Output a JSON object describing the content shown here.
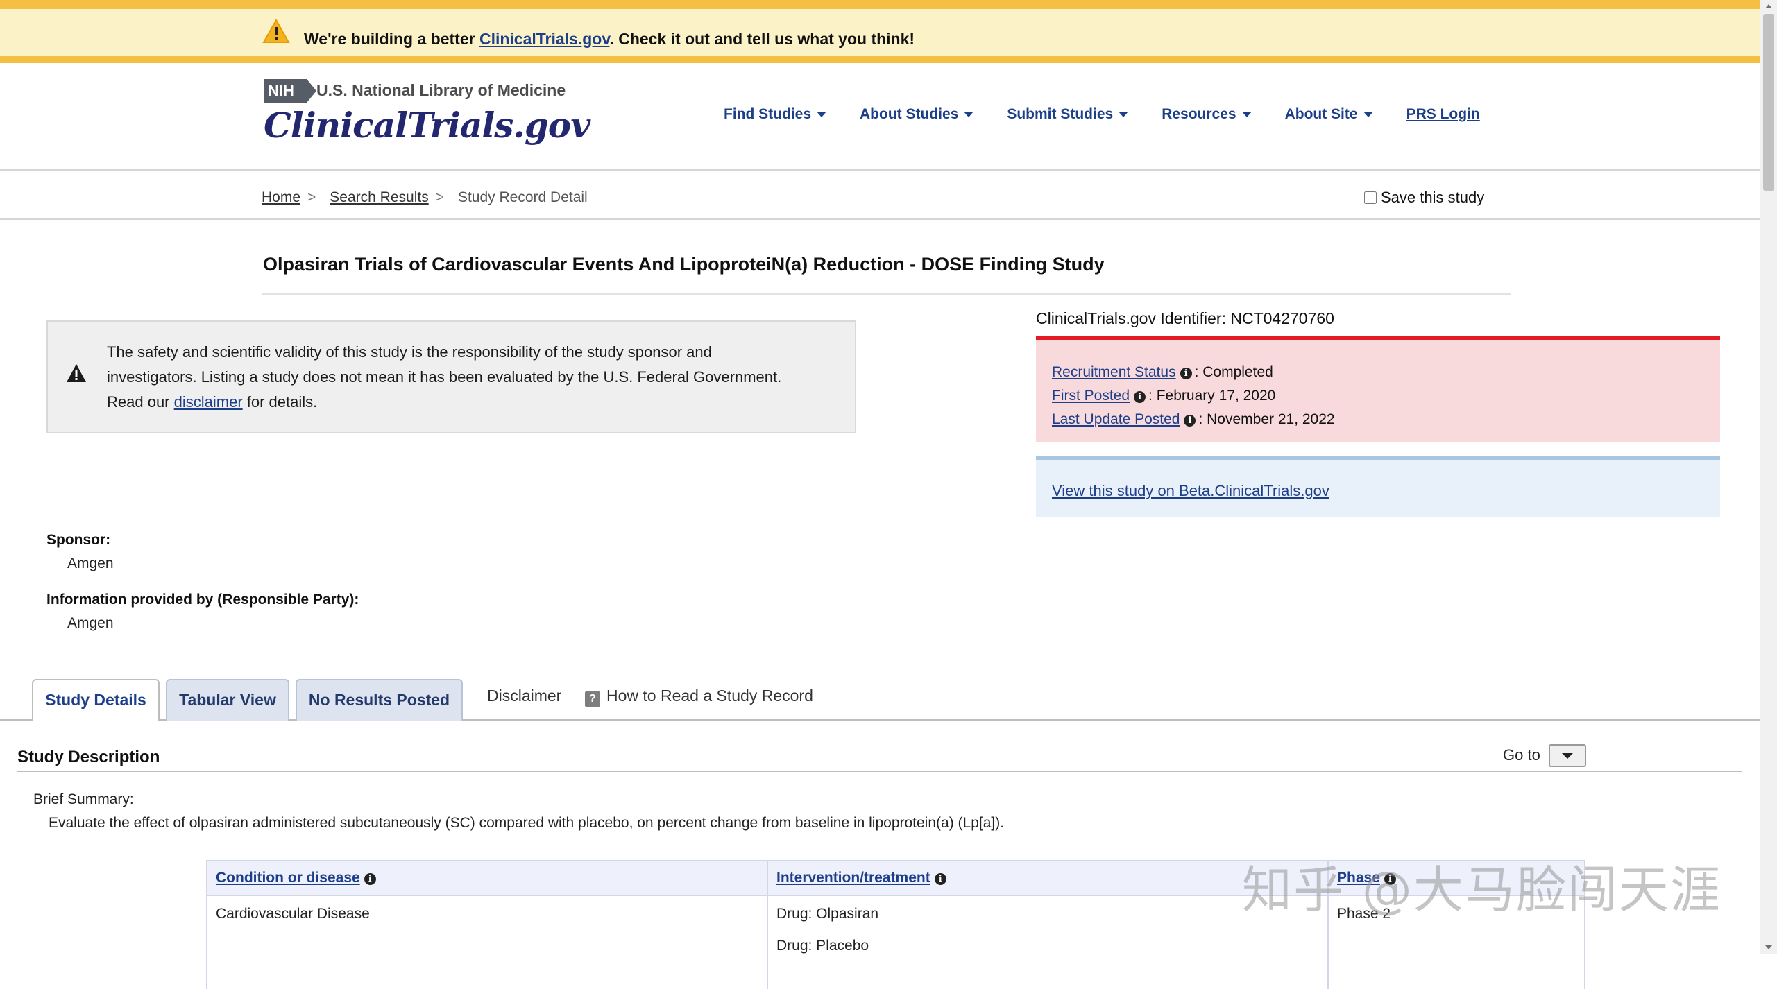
{
  "banner": {
    "prefix": "We're building a better ",
    "link": "ClinicalTrials.gov",
    "suffix": ". Check it out and tell us what you think!"
  },
  "header": {
    "nih_badge": "NIH",
    "org": "U.S. National Library of Medicine",
    "logo": "ClinicalTrials.gov",
    "nav": {
      "find": "Find Studies",
      "about_studies": "About Studies",
      "submit": "Submit Studies",
      "resources": "Resources",
      "about_site": "About Site",
      "prs": "PRS Login"
    }
  },
  "breadcrumb": {
    "home": "Home",
    "search": "Search Results",
    "current": "Study Record Detail",
    "sep": ">"
  },
  "save_study": "Save this study",
  "study": {
    "title": "Olpasiran Trials of Cardiovascular Events And LipoproteiN(a) Reduction - DOSE Finding Study",
    "identifier": "ClinicalTrials.gov Identifier: NCT04270760"
  },
  "disclaimer": {
    "line1": "The safety and scientific validity of this study is the responsibility of the study sponsor and",
    "line2": "investigators. Listing a study does not mean it has been evaluated by the U.S. Federal Government.",
    "line3_pre": "Read our ",
    "line3_link": "disclaimer",
    "line3_post": " for details."
  },
  "status": {
    "recruitment_label": "Recruitment Status",
    "recruitment_value": ": Completed",
    "first_posted_label": "First Posted",
    "first_posted_value": ": February 17, 2020",
    "last_update_label": "Last Update Posted",
    "last_update_value": ": November 21, 2022"
  },
  "beta_link": "View this study on Beta.ClinicalTrials.gov",
  "sponsor": {
    "label": "Sponsor:",
    "value": "Amgen",
    "info_label": "Information provided by (Responsible Party):",
    "info_value": "Amgen"
  },
  "tabs": {
    "details": "Study Details",
    "tabular": "Tabular View",
    "results": "No Results Posted",
    "disclaimer": "Disclaimer",
    "how_icon": "?",
    "how_to": "How to Read a Study Record"
  },
  "description": {
    "title": "Study Description",
    "goto": "Go to",
    "brief_label": "Brief Summary:",
    "brief_text": "Evaluate the effect of olpasiran administered subcutaneously (SC) compared with placebo, on percent change from baseline in lipoprotein(a) (Lp[a])."
  },
  "table": {
    "headers": [
      "Condition or disease",
      "Intervention/treatment",
      "Phase"
    ],
    "condition": "Cardiovascular Disease",
    "interventions": [
      "Drug: Olpasiran",
      "Drug: Placebo"
    ],
    "phase": "Phase 2"
  },
  "watermark": "知乎 @大马脸闯天涯",
  "icons": {
    "banner_warning": "warning-triangle-icon",
    "disclaimer_warning": "warning-triangle-icon",
    "info": "info-circle-icon"
  },
  "colors": {
    "banner_bg": "#fcf2c8",
    "banner_border": "#f4bf42",
    "link": "#1d3f8a",
    "status_bg": "#f8dadd",
    "status_border": "#e31c23",
    "beta_bg": "#e8f1fa"
  }
}
